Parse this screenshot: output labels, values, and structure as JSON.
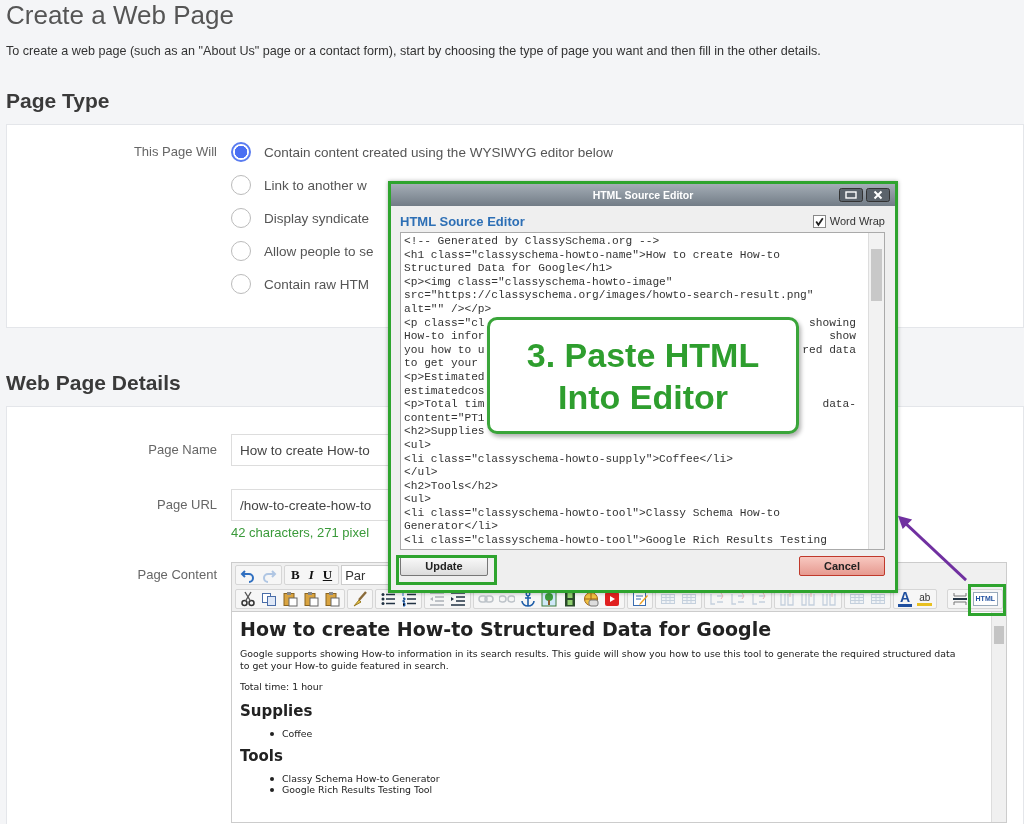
{
  "page": {
    "title": "Create a Web Page",
    "intro": "To create a web page (such as an \"About Us\" page or a contact form), start by choosing the type of page you want and then fill in the other details."
  },
  "page_type": {
    "heading": "Page Type",
    "label": "This Page Will",
    "options": [
      {
        "label": "Contain content created using the WYSIWYG editor below",
        "selected": true
      },
      {
        "label": "Link to another w",
        "selected": false
      },
      {
        "label": "Display syndicate",
        "selected": false
      },
      {
        "label": "Allow people to se",
        "selected": false
      },
      {
        "label": "Contain raw HTM",
        "selected": false
      }
    ]
  },
  "details": {
    "heading": "Web Page Details",
    "page_name": {
      "label": "Page Name",
      "value": "How to create How-to"
    },
    "page_url": {
      "label": "Page URL",
      "value": "/how-to-create-how-to",
      "hint": "42 characters, 271 pixel"
    },
    "page_content": {
      "label": "Page Content",
      "toolbar_top": [
        [
          {
            "kind": "undo",
            "disabled": false
          },
          {
            "kind": "redo",
            "disabled": true
          }
        ],
        [
          {
            "kind": "bold",
            "label": "B",
            "disabled": false
          },
          {
            "kind": "italic",
            "label": "I",
            "disabled": false
          },
          {
            "kind": "underline",
            "label": "U",
            "disabled": false
          }
        ]
      ],
      "format_value": "Par",
      "toolbar_bottom": [
        [
          {
            "kind": "cut",
            "disabled": false
          },
          {
            "kind": "copy",
            "disabled": false
          },
          {
            "kind": "paste",
            "disabled": false
          },
          {
            "kind": "paste",
            "disabled": false
          },
          {
            "kind": "paste",
            "disabled": false
          }
        ],
        [
          {
            "kind": "brush",
            "disabled": false
          }
        ],
        [
          {
            "kind": "bullets",
            "disabled": false
          },
          {
            "kind": "numbers",
            "disabled": false
          }
        ],
        [
          {
            "kind": "outdent",
            "disabled": true
          },
          {
            "kind": "indent",
            "disabled": false
          }
        ],
        [
          {
            "kind": "link",
            "disabled": true
          },
          {
            "kind": "unlink",
            "disabled": true
          },
          {
            "kind": "anchor",
            "disabled": false
          },
          {
            "kind": "image",
            "disabled": false
          },
          {
            "kind": "film",
            "disabled": false
          },
          {
            "kind": "media",
            "disabled": false
          },
          {
            "kind": "video",
            "disabled": false
          }
        ],
        [
          {
            "kind": "edit",
            "disabled": false
          }
        ],
        [
          {
            "kind": "table",
            "disabled": true
          },
          {
            "kind": "table",
            "disabled": true
          }
        ],
        [
          {
            "kind": "rows",
            "disabled": true
          },
          {
            "kind": "rows",
            "disabled": true
          },
          {
            "kind": "rows",
            "disabled": true
          }
        ],
        [
          {
            "kind": "cols",
            "disabled": true
          },
          {
            "kind": "cols",
            "disabled": true
          },
          {
            "kind": "cols",
            "disabled": true
          }
        ],
        [
          {
            "kind": "table",
            "disabled": true
          },
          {
            "kind": "table",
            "disabled": true
          }
        ],
        [
          {
            "kind": "font-color",
            "label": "A",
            "disabled": false
          },
          {
            "kind": "highlight",
            "label": "ab",
            "disabled": false
          }
        ],
        [
          {
            "kind": "rule",
            "disabled": false
          },
          {
            "kind": "html",
            "label": "HTML",
            "disabled": false
          }
        ]
      ],
      "content": [
        {
          "kind": "h1",
          "text": "How to create How-to Structured Data for Google"
        },
        {
          "kind": "p",
          "text": "Google supports showing How-to information in its search results. This guide will show you how to use this tool to generate the required structured data to get your How-to guide featured in search."
        },
        {
          "kind": "p",
          "text": "Total time: 1 hour"
        },
        {
          "kind": "h2",
          "text": "Supplies"
        },
        {
          "kind": "li",
          "text": "Coffee"
        },
        {
          "kind": "h2",
          "text": "Tools"
        },
        {
          "kind": "li",
          "text": "Classy Schema How-to Generator"
        },
        {
          "kind": "li",
          "text": "Google Rich Results Testing Tool"
        }
      ]
    }
  },
  "dialog": {
    "title": "HTML Source Editor",
    "heading": "HTML Source Editor",
    "word_wrap": {
      "label": "Word Wrap",
      "checked": true
    },
    "code_lines": [
      {
        "text": "<!-- Generated by ClassySchema.org -->"
      },
      {
        "text": "<h1 class=\"classyschema-howto-name\">How to create How-to"
      },
      {
        "text": "Structured Data for Google</h1>"
      },
      {
        "text": "<p><img class=\"classyschema-howto-image\""
      },
      {
        "text": "src=\"https://classyschema.org/images/howto-search-result.png\""
      },
      {
        "text": "alt=\"\" /></p>"
      },
      {
        "text": "<p class=\"cl",
        "right": "showing"
      },
      {
        "text": "How-to infor",
        "right": "show"
      },
      {
        "text": "you how to u",
        "right": "red data"
      },
      {
        "text": "to get your"
      },
      {
        "text": "<p>Estimated"
      },
      {
        "text": "estimatedcos"
      },
      {
        "text": "<p>Total tim",
        "right": "data-"
      },
      {
        "text": "content=\"PT1"
      },
      {
        "text": "<h2>Supplies"
      },
      {
        "text": "<ul>"
      },
      {
        "text": "<li class=\"classyschema-howto-supply\">Coffee</li>"
      },
      {
        "text": "</ul>"
      },
      {
        "text": "<h2>Tools</h2>"
      },
      {
        "text": "<ul>"
      },
      {
        "text": "<li class=\"classyschema-howto-tool\">Classy Schema How-to"
      },
      {
        "text": "Generator</li>"
      },
      {
        "text": "<li class=\"classyschema-howto-tool\">Google Rich Results Testing"
      }
    ],
    "update": "Update",
    "cancel": "Cancel"
  },
  "callout": {
    "lines": [
      "3. Paste HTML",
      "Into Editor"
    ]
  }
}
